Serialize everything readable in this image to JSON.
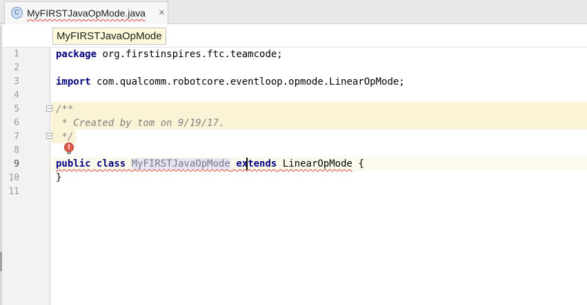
{
  "tab": {
    "icon_letter": "C",
    "title": "MyFIRSTJavaOpMode.java",
    "close_glyph": "×"
  },
  "breadcrumb": {
    "label": "MyFIRSTJavaOpMode"
  },
  "gutter": {
    "line_numbers": [
      "1",
      "2",
      "3",
      "4",
      "5",
      "6",
      "7",
      "8",
      "9",
      "10",
      "11"
    ],
    "current_line": "9"
  },
  "code": {
    "line1": {
      "keyword": "package",
      "text": " org.firstinspires.ftc.teamcode;"
    },
    "line3": {
      "keyword": "import",
      "text": " com.qualcomm.robotcore.eventloop.opmode.LinearOpMode;"
    },
    "line5": {
      "text": "/**"
    },
    "line6": {
      "text": " * Created by tom on 9/19/17."
    },
    "line7": {
      "text": " */"
    },
    "line9": {
      "kw_public": "public",
      "kw_class": "class",
      "class_name": "MyFIRSTJavaOpMode",
      "kw_extends": "extends",
      "superclass": "LinearOpMode",
      "brace_open": " {"
    },
    "line10": {
      "text": "}"
    }
  },
  "intention": {
    "glyph": "!"
  },
  "colors": {
    "keyword": "#000080",
    "comment": "#808080",
    "doc_highlight": "#fbf3d6",
    "error_squiggle": "#e0453a"
  }
}
